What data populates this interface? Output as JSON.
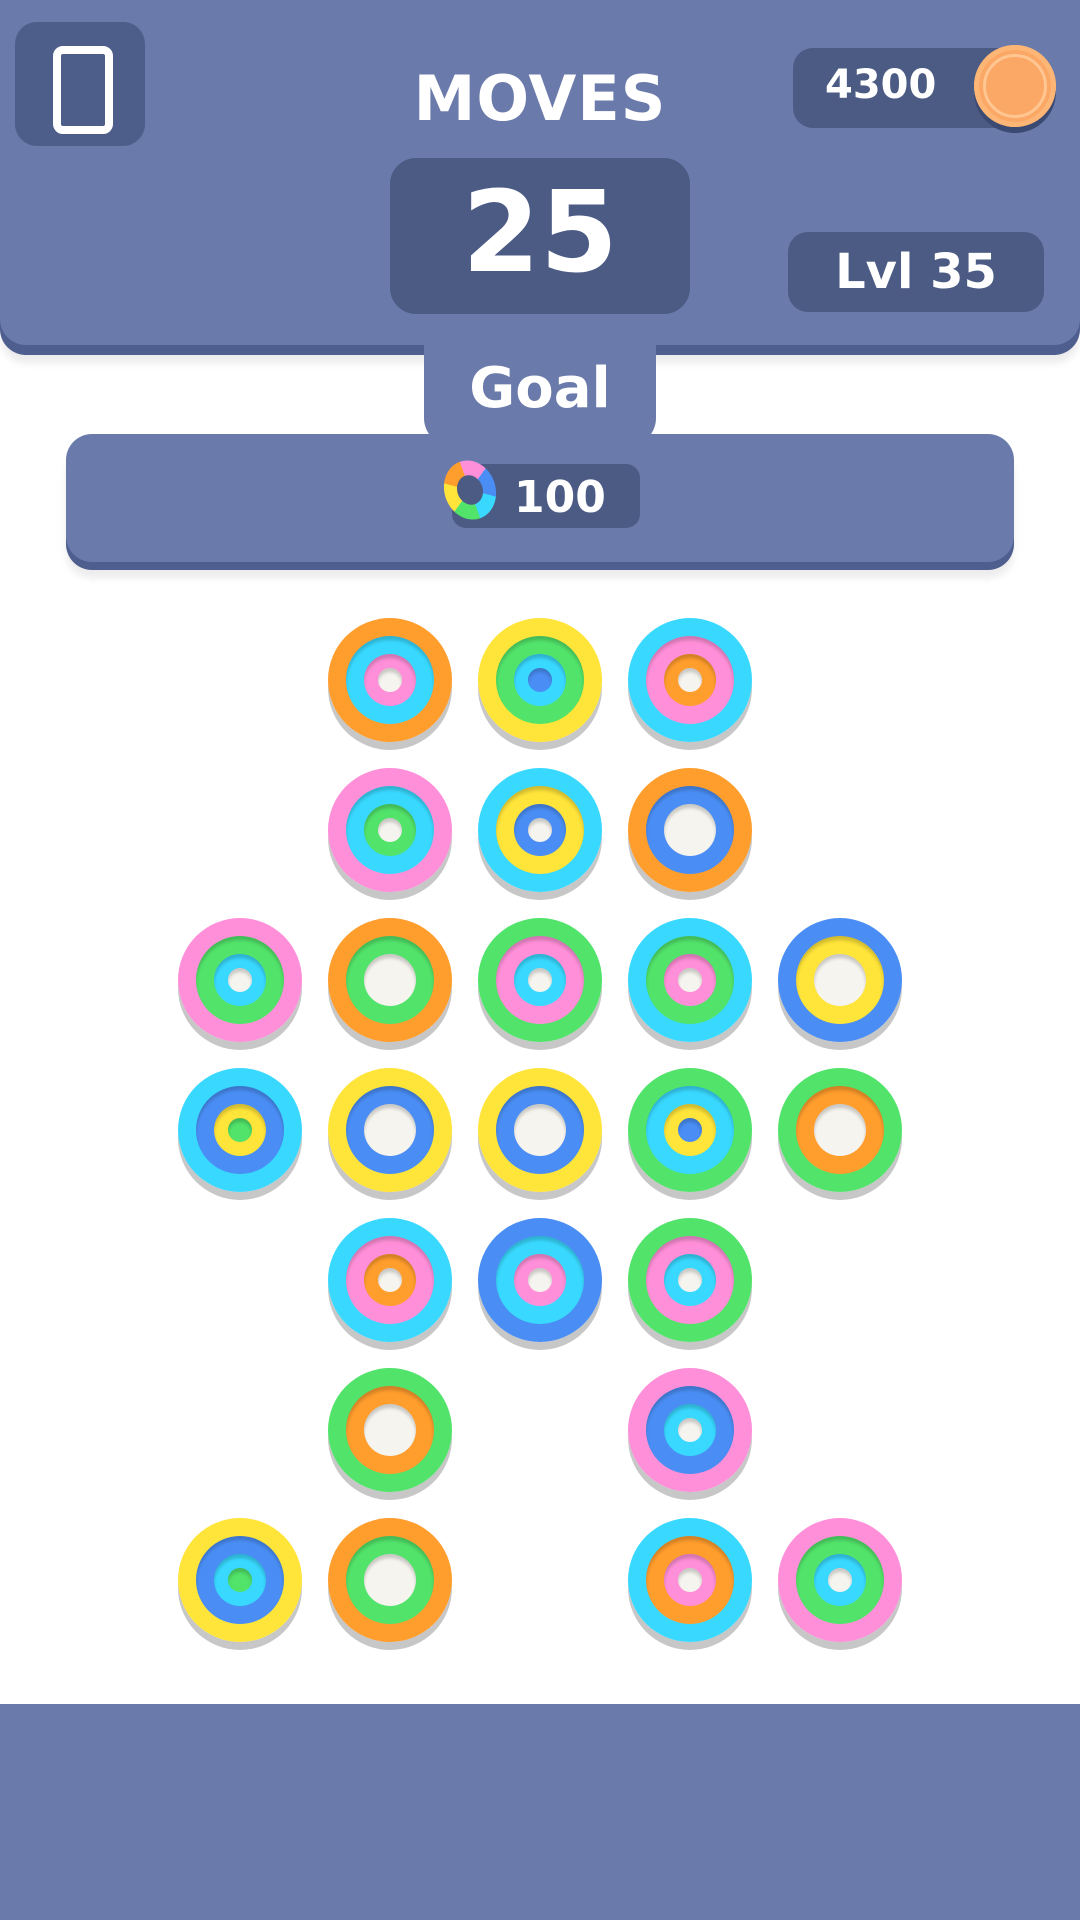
{
  "hud": {
    "moves_label": "MOVES",
    "moves_value": "25",
    "coins": "4300",
    "level": "Lvl 35",
    "coin_icon": "coin-icon",
    "menu_icon": "phone-icon"
  },
  "goal": {
    "label": "Goal",
    "icon": "rainbow-ring-icon",
    "count": "100"
  },
  "colors": {
    "hud_bg": "#6a7aaa",
    "hud_box": "#4b5b84",
    "orange": "#ff9d2d",
    "pink": "#ff8fd8",
    "cyan": "#39d9ff",
    "yellow": "#ffe43a",
    "green": "#52e36a",
    "blue": "#4a8ef5",
    "hole": "#f6f4ef"
  },
  "board": {
    "columns": 5,
    "rows": 7,
    "stacks": [
      {
        "row": 0,
        "col": 1,
        "layers": [
          "orange",
          "cyan",
          "pink",
          "hole"
        ]
      },
      {
        "row": 0,
        "col": 2,
        "layers": [
          "yellow",
          "green",
          "cyan",
          "blue"
        ]
      },
      {
        "row": 0,
        "col": 3,
        "layers": [
          "cyan",
          "pink",
          "orange",
          "hole"
        ]
      },
      {
        "row": 1,
        "col": 1,
        "layers": [
          "pink",
          "cyan",
          "green",
          "hole"
        ]
      },
      {
        "row": 1,
        "col": 2,
        "layers": [
          "cyan",
          "yellow",
          "blue",
          "hole"
        ]
      },
      {
        "row": 1,
        "col": 3,
        "layers": [
          "orange",
          "blue",
          "hole"
        ]
      },
      {
        "row": 2,
        "col": 0,
        "layers": [
          "pink",
          "green",
          "cyan",
          "hole"
        ]
      },
      {
        "row": 2,
        "col": 1,
        "layers": [
          "orange",
          "green",
          "hole"
        ]
      },
      {
        "row": 2,
        "col": 2,
        "layers": [
          "green",
          "pink",
          "cyan",
          "hole"
        ]
      },
      {
        "row": 2,
        "col": 3,
        "layers": [
          "cyan",
          "green",
          "pink",
          "hole"
        ]
      },
      {
        "row": 2,
        "col": 4,
        "layers": [
          "blue",
          "yellow",
          "hole"
        ]
      },
      {
        "row": 3,
        "col": 0,
        "layers": [
          "cyan",
          "blue",
          "yellow",
          "green"
        ]
      },
      {
        "row": 3,
        "col": 1,
        "layers": [
          "yellow",
          "blue",
          "hole"
        ]
      },
      {
        "row": 3,
        "col": 2,
        "layers": [
          "yellow",
          "blue",
          "hole"
        ]
      },
      {
        "row": 3,
        "col": 3,
        "layers": [
          "green",
          "cyan",
          "yellow",
          "blue"
        ]
      },
      {
        "row": 3,
        "col": 4,
        "layers": [
          "green",
          "orange",
          "hole"
        ]
      },
      {
        "row": 4,
        "col": 1,
        "layers": [
          "cyan",
          "pink",
          "orange",
          "hole"
        ]
      },
      {
        "row": 4,
        "col": 2,
        "layers": [
          "blue",
          "cyan",
          "pink",
          "hole"
        ]
      },
      {
        "row": 4,
        "col": 3,
        "layers": [
          "green",
          "pink",
          "cyan",
          "hole"
        ]
      },
      {
        "row": 5,
        "col": 1,
        "layers": [
          "green",
          "orange",
          "hole"
        ]
      },
      {
        "row": 5,
        "col": 3,
        "layers": [
          "pink",
          "blue",
          "cyan",
          "hole"
        ]
      },
      {
        "row": 6,
        "col": 0,
        "layers": [
          "yellow",
          "blue",
          "cyan",
          "green"
        ]
      },
      {
        "row": 6,
        "col": 1,
        "layers": [
          "orange",
          "green",
          "hole"
        ]
      },
      {
        "row": 6,
        "col": 3,
        "layers": [
          "cyan",
          "orange",
          "pink",
          "hole"
        ]
      },
      {
        "row": 6,
        "col": 4,
        "layers": [
          "pink",
          "green",
          "cyan",
          "hole"
        ]
      }
    ]
  }
}
